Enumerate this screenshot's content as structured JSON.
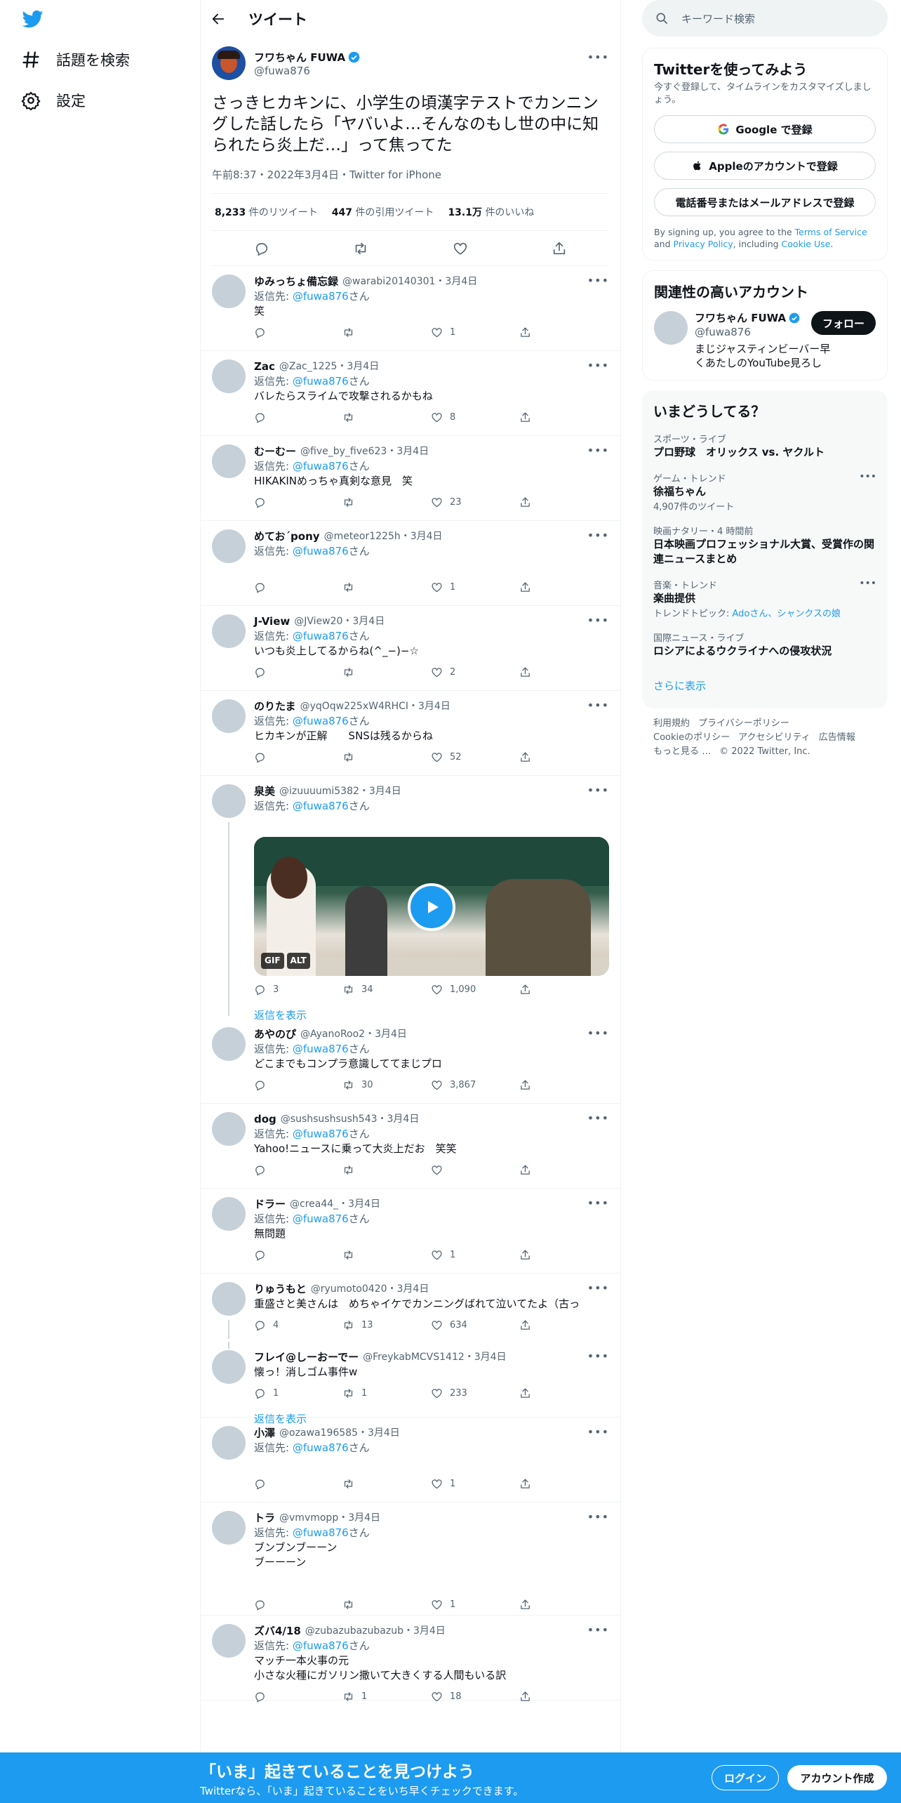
{
  "nav": {
    "explore": "話題を検索",
    "settings": "設定"
  },
  "header": {
    "title": "ツイート"
  },
  "tweet": {
    "name": "フワちゃん FUWA",
    "handle": "@fuwa876",
    "text": "さっきヒカキンに、小学生の頃漢字テストでカンニングした話したら「ヤバいよ…そんなのもし世の中に知られたら炎上だ…」って焦ってた",
    "meta": "午前8:37・2022年3月4日・Twitter for iPhone",
    "retweets_num": "8,233",
    "retweets_label": "件のリツイート",
    "quotes_num": "447",
    "quotes_label": "件の引用ツイート",
    "likes_num": "13.1万",
    "likes_label": "件のいいね"
  },
  "reply_to_label": "返信先: ",
  "reply_to_handle": "@fuwa876",
  "reply_to_suffix": "さん",
  "show_replies": "返信を表示",
  "replies": [
    {
      "name": "ゆみっちょ備忘録",
      "handle": "@warabi20140301・3月4日",
      "text": "笑",
      "reply": "",
      "rt": "",
      "like": "1"
    },
    {
      "name": "Zac",
      "handle": "@Zac_1225・3月4日",
      "text": "バレたらスライムで攻撃されるかもね",
      "reply": "",
      "rt": "",
      "like": "8"
    },
    {
      "name": "むーむー",
      "handle": "@five_by_five623・3月4日",
      "text": "HIKAKINめっちゃ真剣な意見　笑",
      "reply": "",
      "rt": "",
      "like": "23"
    },
    {
      "name": "めておˊpony",
      "handle": "@meteor1225h・3月4日",
      "text": "",
      "reply": "",
      "rt": "",
      "like": "1"
    },
    {
      "name": "J-View",
      "handle": "@JView20・3月4日",
      "text": "いつも炎上してるからね(^_−)−☆",
      "reply": "",
      "rt": "",
      "like": "2"
    },
    {
      "name": "のりたま",
      "handle": "@yqOqw225xW4RHCI・3月4日",
      "text": "ヒカキンが正解　　SNSは残るからね",
      "reply": "",
      "rt": "",
      "like": "52"
    },
    {
      "name": "泉美",
      "handle": "@izuuuumi5382・3月4日",
      "text": "",
      "reply": "3",
      "rt": "34",
      "like": "1,090",
      "gif": "GIF",
      "alt": "ALT"
    },
    {
      "name": "あやのぴ",
      "handle": "@AyanoRoo2・3月4日",
      "text": "どこまでもコンプラ意識しててまじプロ",
      "reply": "",
      "rt": "30",
      "like": "3,867"
    },
    {
      "name": "dog",
      "handle": "@sushsushsush543・3月4日",
      "text": "Yahoo!ニュースに乗って大炎上だお　笑笑",
      "reply": "",
      "rt": "",
      "like": ""
    },
    {
      "name": "ドラー",
      "handle": "@crea44_・3月4日",
      "text": "無問題",
      "reply": "",
      "rt": "",
      "like": "1"
    },
    {
      "name": "りゅうもと",
      "handle": "@ryumoto0420・3月4日",
      "text": "重盛さと美さんは　めちゃイケでカンニングばれて泣いてたよ（古っ",
      "reply": "4",
      "rt": "13",
      "like": "634"
    },
    {
      "name": "フレイ@しーおーでー",
      "handle": "@FreykabMCVS1412・3月4日",
      "text": "懐っ！消しゴム事件w",
      "reply": "1",
      "rt": "1",
      "like": "233"
    },
    {
      "name": "小澤",
      "handle": "@ozawa196585・3月4日",
      "text": "",
      "reply": "",
      "rt": "",
      "like": "1"
    },
    {
      "name": "トラ",
      "handle": "@vmvmopp・3月4日",
      "text": "ブンブンブーーン\nブーーーン",
      "reply": "",
      "rt": "",
      "like": "1"
    },
    {
      "name": "ズバ4/18",
      "handle": "@zubazubazubazub・3月4日",
      "text": "マッチ一本火事の元\n小さな火種にガソリン撒いて大きくする人間もいる訳",
      "reply": "",
      "rt": "1",
      "like": "18"
    }
  ],
  "search": {
    "placeholder": "キーワード検索"
  },
  "signup": {
    "title": "Twitterを使ってみよう",
    "sub": "今すぐ登録して、タイムラインをカスタマイズしましょう。",
    "google": "Google で登録",
    "apple": "Appleのアカウントで登録",
    "phone": "電話番号またはメールアドレスで登録",
    "legal_1": "By signing up, you agree to the ",
    "tos": "Terms of Service",
    "legal_2": " and ",
    "privacy": "Privacy Policy",
    "legal_3": ", including ",
    "cookie": "Cookie Use",
    "legal_4": "."
  },
  "related": {
    "title": "関連性の高いアカウント",
    "name": "フワちゃん FUWA",
    "handle": "@fuwa876",
    "bio": "まじジャスティンビーバー早くあたしのYouTube見ろし",
    "follow": "フォロー"
  },
  "trends": {
    "title": "いまどうしてる？",
    "items": [
      {
        "cat": "スポーツ・ライブ",
        "title": "プロ野球　オリックス vs. ヤクルト",
        "sub": ""
      },
      {
        "cat": "ゲーム・トレンド",
        "title": "徐福ちゃん",
        "sub": "4,907件のツイート"
      },
      {
        "cat": "映画ナタリー・4 時間前",
        "title": "日本映画プロフェッショナル大賞、受賞作の関連ニュースまとめ",
        "sub": ""
      },
      {
        "cat": "音楽・トレンド",
        "title": "楽曲提供",
        "sub": "トレンドトピック: ",
        "sub_link": "Adoさん、シャンクスの娘"
      },
      {
        "cat": "国際ニュース・ライブ",
        "title": "ロシアによるウクライナへの侵攻状況",
        "sub": ""
      }
    ],
    "show_more": "さらに表示"
  },
  "footer": {
    "l1": "利用規約",
    "l2": "プライバシーポリシー",
    "l3": "Cookieのポリシー",
    "l4": "アクセシビリティ",
    "l5": "広告情報",
    "l6": "もっと見る …",
    "l7": "© 2022 Twitter, Inc."
  },
  "banner": {
    "big": "「いま」起きていることを見つけよう",
    "small": "Twitterなら、「いま」起きていることをいち早くチェックできます。",
    "login": "ログイン",
    "signup": "アカウント作成"
  },
  "colors": {
    "accent": "#1d9bf0",
    "text": "#0f1419",
    "muted": "#536471"
  }
}
